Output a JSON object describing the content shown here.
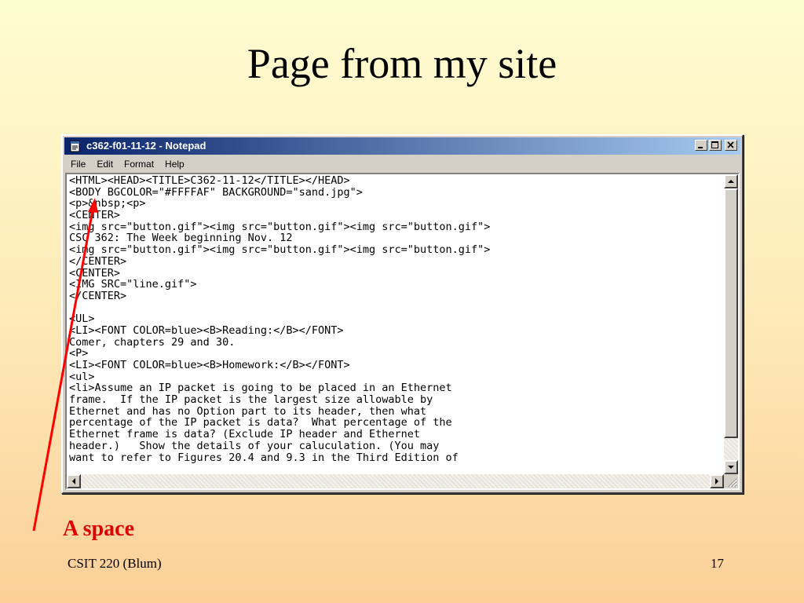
{
  "slide": {
    "title": "Page from my site",
    "caption": "A space",
    "footer_left": "CSIT 220 (Blum)",
    "footer_right": "17"
  },
  "notepad": {
    "title": "c362-f01-11-12 - Notepad",
    "menu": [
      {
        "label": "File"
      },
      {
        "label": "Edit"
      },
      {
        "label": "Format"
      },
      {
        "label": "Help"
      }
    ],
    "lines": [
      "<HTML><HEAD><TITLE>C362-11-12</TITLE></HEAD>",
      "<BODY BGCOLOR=\"#FFFFAF\" BACKGROUND=\"sand.jpg\">",
      "<p>&nbsp;<p>",
      "<CENTER>",
      "<img src=\"button.gif\"><img src=\"button.gif\"><img src=\"button.gif\">",
      "CSC 362: The Week beginning Nov. 12",
      "<img src=\"button.gif\"><img src=\"button.gif\"><img src=\"button.gif\">",
      "</CENTER>",
      "<CENTER>",
      "<IMG SRC=\"line.gif\">",
      "</CENTER>",
      "",
      "<UL>",
      "<LI><FONT COLOR=blue><B>Reading:</B></FONT>",
      "Comer, chapters 29 and 30.",
      "<P>",
      "<LI><FONT COLOR=blue><B>Homework:</B></FONT>",
      "<ul>",
      "<li>Assume an IP packet is going to be placed in an Ethernet",
      "frame.  If the IP packet is the largest size allowable by",
      "Ethernet and has no Option part to its header, then what",
      "percentage of the IP packet is data?  What percentage of the",
      "Ethernet frame is data? (Exclude IP header and Ethernet",
      "header.)   Show the details of your caluculation. (You may",
      "want to refer to Figures 20.4 and 9.3 in the Third Edition of"
    ]
  },
  "colors": {
    "titlebar_start": "#0a246a",
    "titlebar_end": "#a6caf0",
    "caption": "#e00000",
    "arrow": "#ff0000"
  },
  "icons": {
    "app": "notepad-icon",
    "minimize": "minimize-icon",
    "maximize": "maximize-icon",
    "close": "close-icon"
  }
}
